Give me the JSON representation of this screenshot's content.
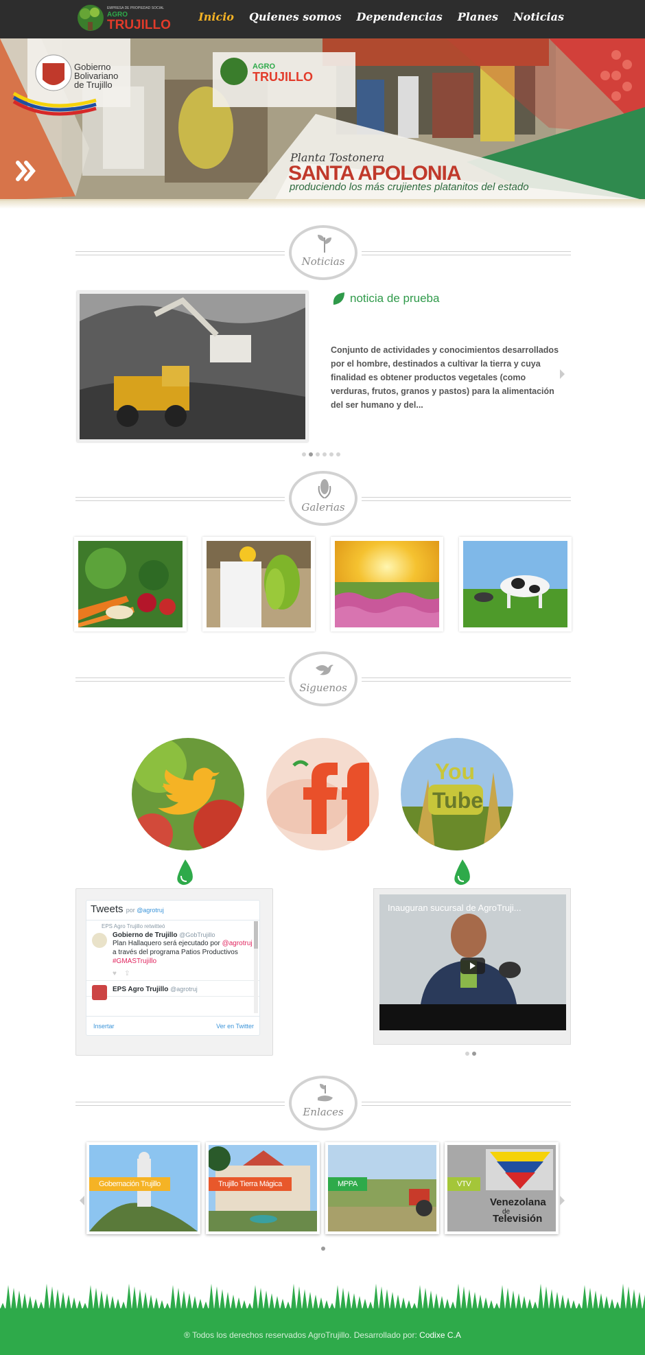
{
  "nav": {
    "logo_small": "EMPRESA DE PROPIEDAD SOCIAL",
    "logo_agro": "AGRO",
    "logo_main": "TRUJILLO",
    "items": [
      {
        "label": "Inicio",
        "active": true
      },
      {
        "label": "Quienes somos",
        "active": false
      },
      {
        "label": "Dependencias",
        "active": false
      },
      {
        "label": "Planes",
        "active": false
      },
      {
        "label": "Noticias",
        "active": false
      }
    ]
  },
  "hero": {
    "gov_line1": "Gobierno",
    "gov_line2": "Bolivariano",
    "gov_line3": "de Trujillo",
    "title_small": "Planta Tostonera",
    "title_big": "SANTA APOLONIA",
    "subtitle": "produciendo los más crujientes platanitos del estado"
  },
  "sections": {
    "news": "Noticias",
    "gallery": "Galerias",
    "follow": "Siguenos",
    "links": "Enlaces"
  },
  "news": {
    "title": "noticia de prueba",
    "body": "Conjunto de actividades y conocimientos desarrollados por el hombre, destinados a cultivar la tierra y cuya finalidad es obtener productos vegetales (como verduras, frutos, granos y pastos) para la alimentación del ser humano y del...",
    "dots_total": 6,
    "dot_active": 2
  },
  "twitter": {
    "header": "Tweets",
    "by": "por",
    "handle": "@agrotruj",
    "tweets": [
      {
        "retweet": "EPS Agro Trujillo retwitteó",
        "name": "Gobierno de Trujillo",
        "user": "@GobTrujillo",
        "text_1": "Plan Hallaquero será ejecutado por",
        "mention": "@agrotruj",
        "text_2": "a través del programa Patios Productivos",
        "hashtag": "#GMASTrujillo"
      },
      {
        "name": "EPS Agro Trujillo",
        "user": "@agrotruj"
      }
    ],
    "embed": "Insertar",
    "view": "Ver en Twitter"
  },
  "video": {
    "title": "Inauguran sucursal de AgroTruji..."
  },
  "links": [
    {
      "label": "Gobernación Trujillo",
      "color": "#f5b325"
    },
    {
      "label": "Trujillo Tierra Mágica",
      "color": "#e8582b"
    },
    {
      "label": "MPPA",
      "color": "#2eaa4a"
    },
    {
      "label": "VTV",
      "color": "#a4c639"
    }
  ],
  "vtv_sign_1": "Venezolana",
  "vtv_sign_2": "de",
  "vtv_sign_3": "Televisión",
  "footer": {
    "text": "® Todos los derechos reservados AgroTrujillo. Desarrollado por:",
    "developer": "Codixe C.A"
  }
}
